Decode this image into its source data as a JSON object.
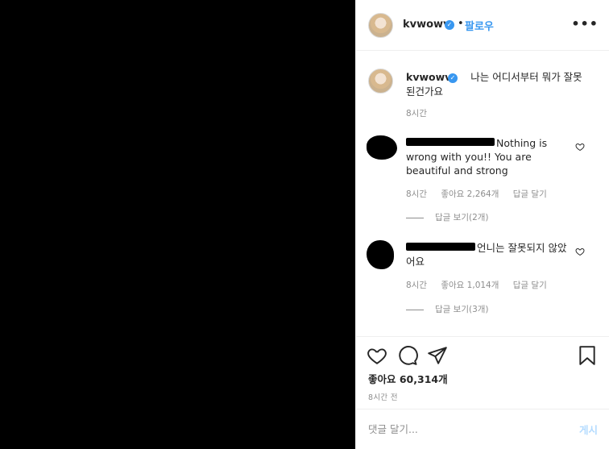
{
  "header": {
    "username": "kvwowv",
    "separator": "•",
    "follow_label": "팔로우",
    "more_label": "•••"
  },
  "caption": {
    "username": "kvwowv",
    "text": "나는 어디서부터 뭐가 잘못 된건가요",
    "time": "8시간"
  },
  "comments": [
    {
      "text": "Nothing is wrong with you!! You are beautiful and strong",
      "time": "8시간",
      "likes": "좋아요 2,264개",
      "reply": "답글 달기",
      "view_replies": "답글 보기(2개)"
    },
    {
      "text": "언니는 잘못되지 않았어요",
      "time": "8시간",
      "likes": "좋아요 1,014개",
      "reply": "답글 달기",
      "view_replies": "답글 보기(3개)"
    }
  ],
  "actions": {
    "likes_count": "좋아요 60,314개",
    "posted_ago": "8시간 전"
  },
  "comment_box": {
    "placeholder": "댓글 달기...",
    "post_label": "게시"
  },
  "colors": {
    "accent": "#3897f0",
    "text": "#262626",
    "muted": "#8e8e8e",
    "photo_bg": "#000000"
  }
}
